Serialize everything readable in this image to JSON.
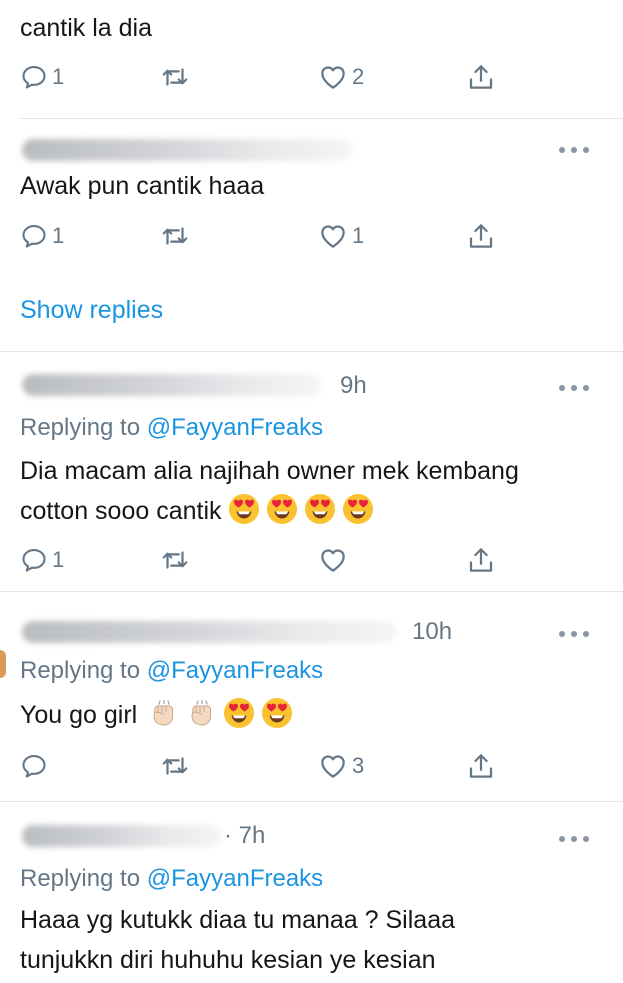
{
  "tweets": [
    {
      "text": "cantik la dia",
      "actions": {
        "reply": "1",
        "retweet": "",
        "like": "2"
      }
    },
    {
      "text": "Awak pun cantik haaa",
      "actions": {
        "reply": "1",
        "retweet": "",
        "like": "1"
      },
      "show_replies": "Show replies"
    },
    {
      "time": "9h",
      "replying_prefix": "Replying to ",
      "replying_handle": "@FayyanFreaks",
      "text_line1": "Dia macam alia najihah owner mek kembang",
      "text_line2": "cotton sooo cantik",
      "emojis": [
        "heart-eyes-emoji",
        "heart-eyes-emoji",
        "heart-eyes-emoji",
        "heart-eyes-emoji"
      ],
      "actions": {
        "reply": "1",
        "retweet": "",
        "like": ""
      }
    },
    {
      "time": "10h",
      "replying_prefix": "Replying to ",
      "replying_handle": "@FayyanFreaks",
      "text": "You go girl",
      "emojis": [
        "raised-fist-emoji",
        "raised-fist-emoji",
        "heart-eyes-emoji",
        "heart-eyes-emoji"
      ],
      "actions": {
        "reply": "",
        "retweet": "",
        "like": "3"
      }
    },
    {
      "time": "· 7h",
      "replying_prefix": "Replying to ",
      "replying_handle": "@FayyanFreaks",
      "text_line1": "Haaa yg kutukk diaa tu manaa ? Silaaa",
      "text_line2": "tunjukkn diri huhuhu kesian ye kesian"
    }
  ],
  "icons": {
    "reply": "reply-icon",
    "retweet": "retweet-icon",
    "like": "heart-icon",
    "share": "share-icon",
    "more": "more-options-icon"
  },
  "colors": {
    "text": "#14171a",
    "secondary": "#657786",
    "link": "#1b95e0",
    "divider": "#e1e8ed"
  }
}
